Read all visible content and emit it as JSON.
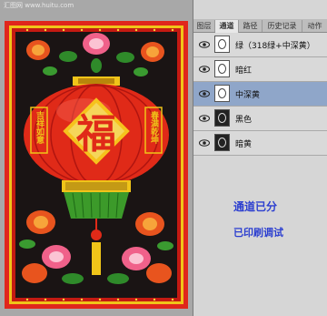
{
  "watermark": "汇图网 www.huitu.com",
  "artwork": {
    "center_char": "福",
    "left_text": "吉祥如意",
    "right_text": "春满乾坤"
  },
  "panel": {
    "tabs": [
      {
        "label": "图层",
        "active": false
      },
      {
        "label": "通道",
        "active": true
      },
      {
        "label": "路径",
        "active": false
      },
      {
        "label": "历史记录",
        "active": false
      },
      {
        "label": "动作",
        "active": false
      }
    ],
    "channels": [
      {
        "label": "绿（318绿+中深黄）",
        "selected": false
      },
      {
        "label": "暗红",
        "selected": false
      },
      {
        "label": "中深黄",
        "selected": true
      },
      {
        "label": "黑色",
        "selected": false
      },
      {
        "label": "暗黄",
        "selected": false
      }
    ]
  },
  "info": {
    "line1": "通道已分",
    "line2": "已印刷调试"
  },
  "colors": {
    "border_red": "#e0261c",
    "border_gold": "#f0c419",
    "lantern_red": "#e02a18",
    "highlight_blue": "#8fa6c9",
    "info_blue": "#2c3fd0"
  }
}
